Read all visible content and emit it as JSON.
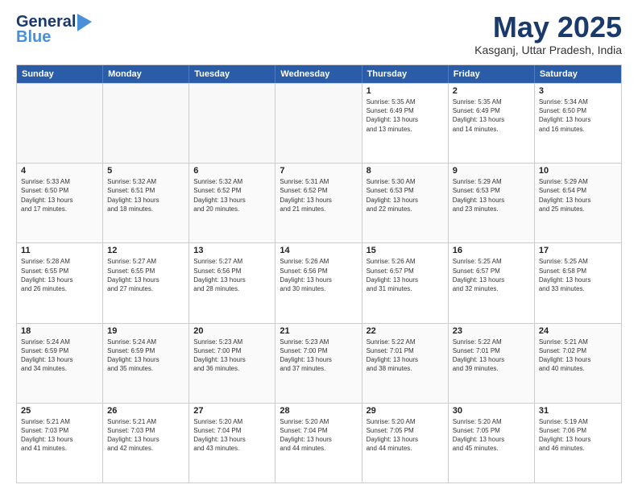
{
  "logo": {
    "line1": "General",
    "line2": "Blue"
  },
  "header": {
    "month": "May 2025",
    "location": "Kasganj, Uttar Pradesh, India"
  },
  "days": [
    "Sunday",
    "Monday",
    "Tuesday",
    "Wednesday",
    "Thursday",
    "Friday",
    "Saturday"
  ],
  "weeks": [
    [
      {
        "day": "",
        "info": ""
      },
      {
        "day": "",
        "info": ""
      },
      {
        "day": "",
        "info": ""
      },
      {
        "day": "",
        "info": ""
      },
      {
        "day": "1",
        "info": "Sunrise: 5:35 AM\nSunset: 6:49 PM\nDaylight: 13 hours\nand 13 minutes."
      },
      {
        "day": "2",
        "info": "Sunrise: 5:35 AM\nSunset: 6:49 PM\nDaylight: 13 hours\nand 14 minutes."
      },
      {
        "day": "3",
        "info": "Sunrise: 5:34 AM\nSunset: 6:50 PM\nDaylight: 13 hours\nand 16 minutes."
      }
    ],
    [
      {
        "day": "4",
        "info": "Sunrise: 5:33 AM\nSunset: 6:50 PM\nDaylight: 13 hours\nand 17 minutes."
      },
      {
        "day": "5",
        "info": "Sunrise: 5:32 AM\nSunset: 6:51 PM\nDaylight: 13 hours\nand 18 minutes."
      },
      {
        "day": "6",
        "info": "Sunrise: 5:32 AM\nSunset: 6:52 PM\nDaylight: 13 hours\nand 20 minutes."
      },
      {
        "day": "7",
        "info": "Sunrise: 5:31 AM\nSunset: 6:52 PM\nDaylight: 13 hours\nand 21 minutes."
      },
      {
        "day": "8",
        "info": "Sunrise: 5:30 AM\nSunset: 6:53 PM\nDaylight: 13 hours\nand 22 minutes."
      },
      {
        "day": "9",
        "info": "Sunrise: 5:29 AM\nSunset: 6:53 PM\nDaylight: 13 hours\nand 23 minutes."
      },
      {
        "day": "10",
        "info": "Sunrise: 5:29 AM\nSunset: 6:54 PM\nDaylight: 13 hours\nand 25 minutes."
      }
    ],
    [
      {
        "day": "11",
        "info": "Sunrise: 5:28 AM\nSunset: 6:55 PM\nDaylight: 13 hours\nand 26 minutes."
      },
      {
        "day": "12",
        "info": "Sunrise: 5:27 AM\nSunset: 6:55 PM\nDaylight: 13 hours\nand 27 minutes."
      },
      {
        "day": "13",
        "info": "Sunrise: 5:27 AM\nSunset: 6:56 PM\nDaylight: 13 hours\nand 28 minutes."
      },
      {
        "day": "14",
        "info": "Sunrise: 5:26 AM\nSunset: 6:56 PM\nDaylight: 13 hours\nand 30 minutes."
      },
      {
        "day": "15",
        "info": "Sunrise: 5:26 AM\nSunset: 6:57 PM\nDaylight: 13 hours\nand 31 minutes."
      },
      {
        "day": "16",
        "info": "Sunrise: 5:25 AM\nSunset: 6:57 PM\nDaylight: 13 hours\nand 32 minutes."
      },
      {
        "day": "17",
        "info": "Sunrise: 5:25 AM\nSunset: 6:58 PM\nDaylight: 13 hours\nand 33 minutes."
      }
    ],
    [
      {
        "day": "18",
        "info": "Sunrise: 5:24 AM\nSunset: 6:59 PM\nDaylight: 13 hours\nand 34 minutes."
      },
      {
        "day": "19",
        "info": "Sunrise: 5:24 AM\nSunset: 6:59 PM\nDaylight: 13 hours\nand 35 minutes."
      },
      {
        "day": "20",
        "info": "Sunrise: 5:23 AM\nSunset: 7:00 PM\nDaylight: 13 hours\nand 36 minutes."
      },
      {
        "day": "21",
        "info": "Sunrise: 5:23 AM\nSunset: 7:00 PM\nDaylight: 13 hours\nand 37 minutes."
      },
      {
        "day": "22",
        "info": "Sunrise: 5:22 AM\nSunset: 7:01 PM\nDaylight: 13 hours\nand 38 minutes."
      },
      {
        "day": "23",
        "info": "Sunrise: 5:22 AM\nSunset: 7:01 PM\nDaylight: 13 hours\nand 39 minutes."
      },
      {
        "day": "24",
        "info": "Sunrise: 5:21 AM\nSunset: 7:02 PM\nDaylight: 13 hours\nand 40 minutes."
      }
    ],
    [
      {
        "day": "25",
        "info": "Sunrise: 5:21 AM\nSunset: 7:03 PM\nDaylight: 13 hours\nand 41 minutes."
      },
      {
        "day": "26",
        "info": "Sunrise: 5:21 AM\nSunset: 7:03 PM\nDaylight: 13 hours\nand 42 minutes."
      },
      {
        "day": "27",
        "info": "Sunrise: 5:20 AM\nSunset: 7:04 PM\nDaylight: 13 hours\nand 43 minutes."
      },
      {
        "day": "28",
        "info": "Sunrise: 5:20 AM\nSunset: 7:04 PM\nDaylight: 13 hours\nand 44 minutes."
      },
      {
        "day": "29",
        "info": "Sunrise: 5:20 AM\nSunset: 7:05 PM\nDaylight: 13 hours\nand 44 minutes."
      },
      {
        "day": "30",
        "info": "Sunrise: 5:20 AM\nSunset: 7:05 PM\nDaylight: 13 hours\nand 45 minutes."
      },
      {
        "day": "31",
        "info": "Sunrise: 5:19 AM\nSunset: 7:06 PM\nDaylight: 13 hours\nand 46 minutes."
      }
    ]
  ]
}
